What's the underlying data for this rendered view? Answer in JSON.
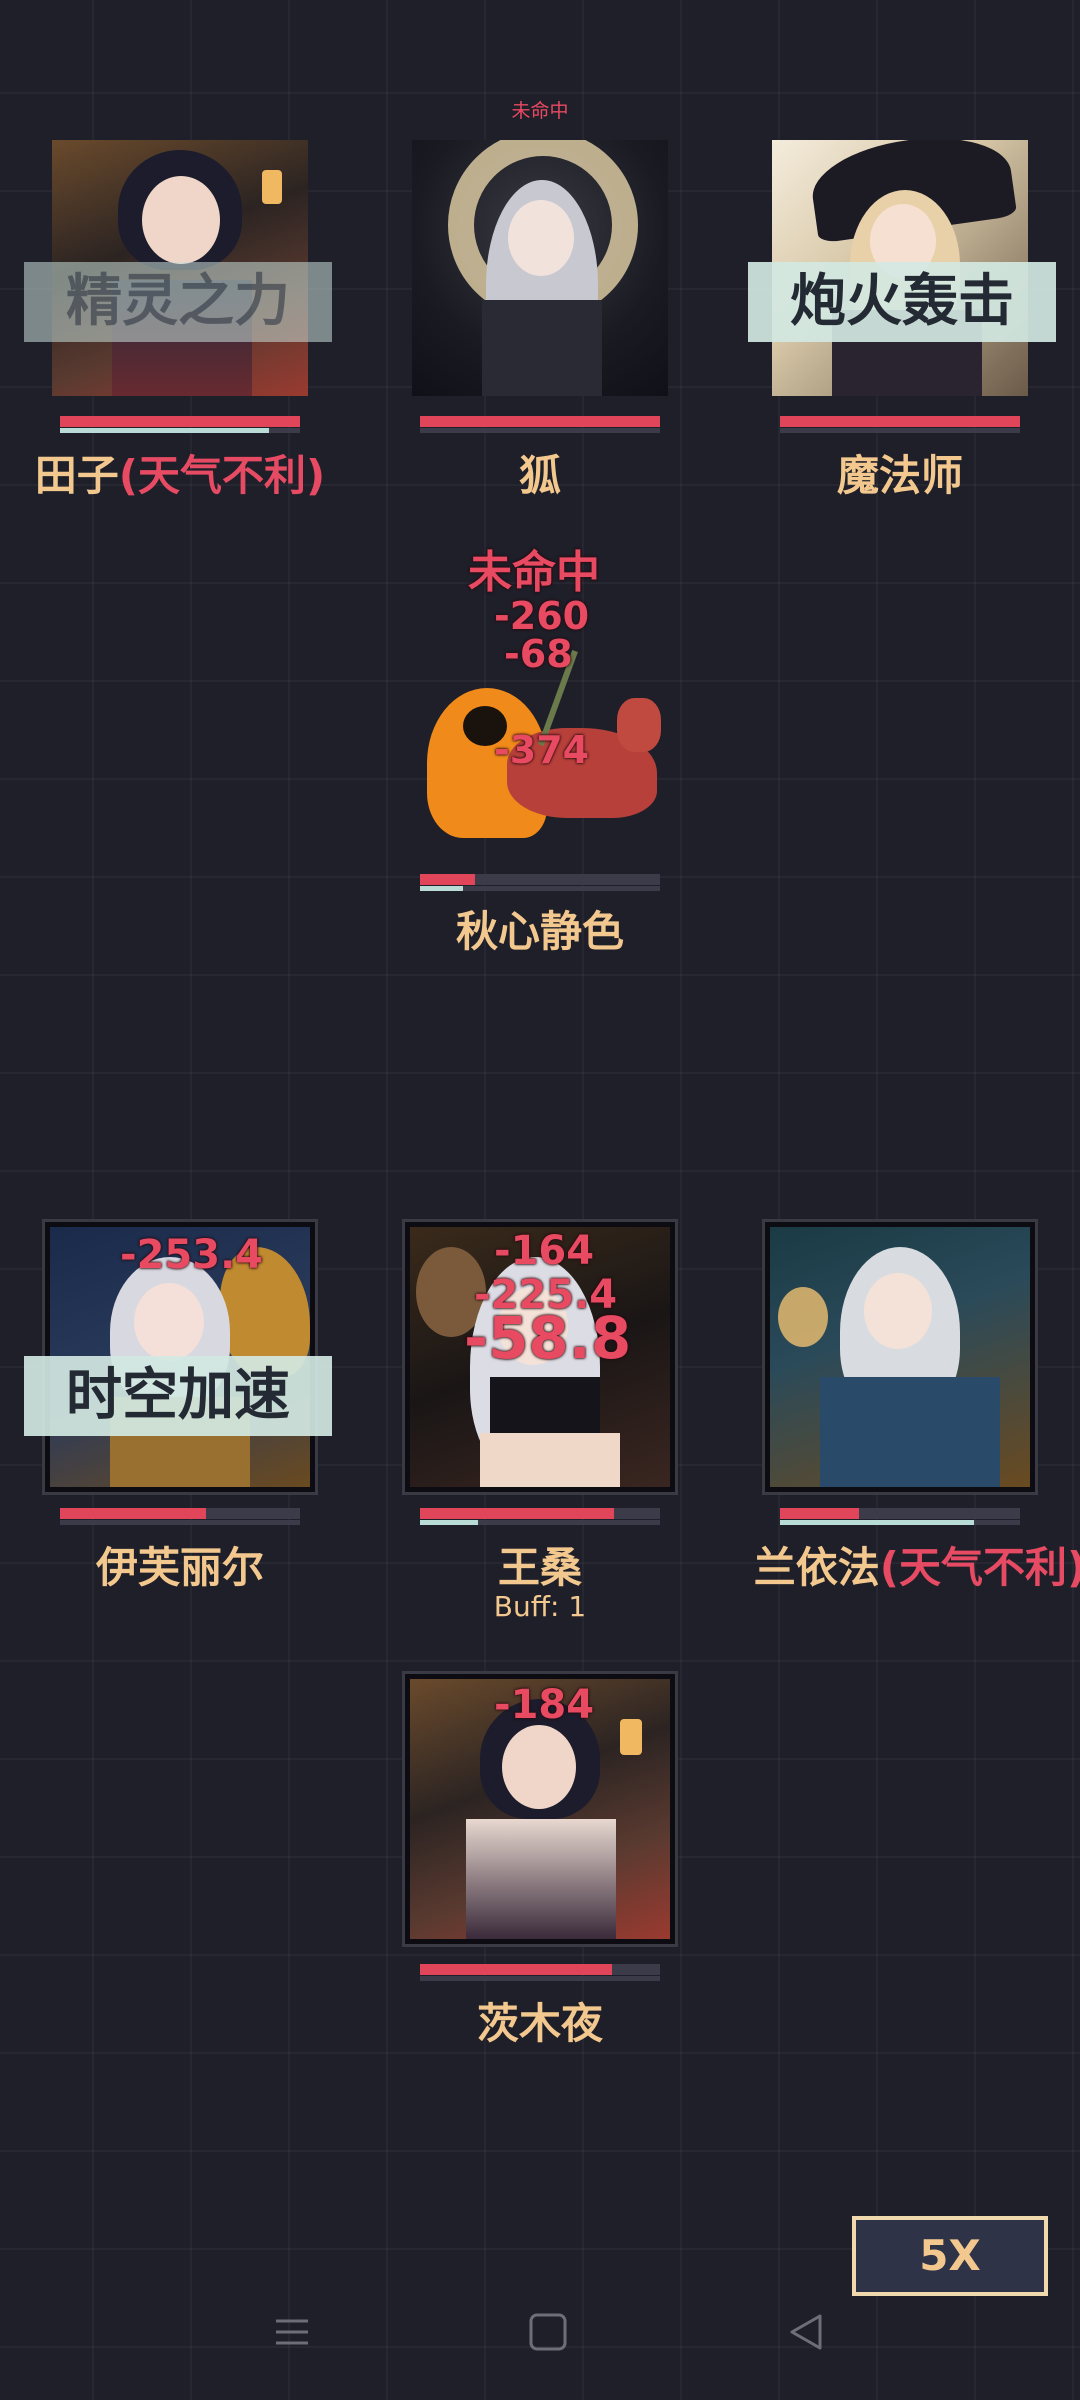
{
  "top_status": "未命中",
  "cards": {
    "tianzi": {
      "name": "田子",
      "debuff": "(天气不利)",
      "skill": "精灵之力",
      "hp": 1.0,
      "mp": 0.87
    },
    "hu": {
      "name": "狐",
      "hp": 1.0,
      "mp": 0.0
    },
    "mofashi": {
      "name": "魔法师",
      "skill": "炮火轰击",
      "hp": 1.0,
      "mp": 0.0
    },
    "boss": {
      "name": "秋心静色",
      "hp": 0.23,
      "mp": 0.18,
      "damage": [
        "未命中",
        "-260",
        "-68",
        "-374"
      ]
    },
    "yifu": {
      "name": "伊芙丽尔",
      "skill": "时空加速",
      "hp": 0.61,
      "mp": 0.0,
      "damage": [
        "-253.4"
      ]
    },
    "wangsang": {
      "name": "王桑",
      "buff": "Buff: 1",
      "hp": 0.81,
      "mp": 0.24,
      "damage": [
        "-164",
        "-225.4",
        "-58.8"
      ]
    },
    "lanyifa": {
      "name": "兰依法",
      "debuff": "(天气不利)",
      "hp": 0.33,
      "mp": 0.81
    },
    "cimuye": {
      "name": "茨木夜",
      "hp": 0.8,
      "mp": 0.0,
      "damage": [
        "-184"
      ]
    }
  },
  "speed_label": "5X",
  "navbar": {
    "menu_icon": "menu-icon",
    "home_icon": "home-icon",
    "back_icon": "back-icon"
  },
  "colors": {
    "hp": "#e0455a",
    "mp": "#b9dcd6",
    "name": "#f3c88e",
    "damage": "#e84a62"
  }
}
